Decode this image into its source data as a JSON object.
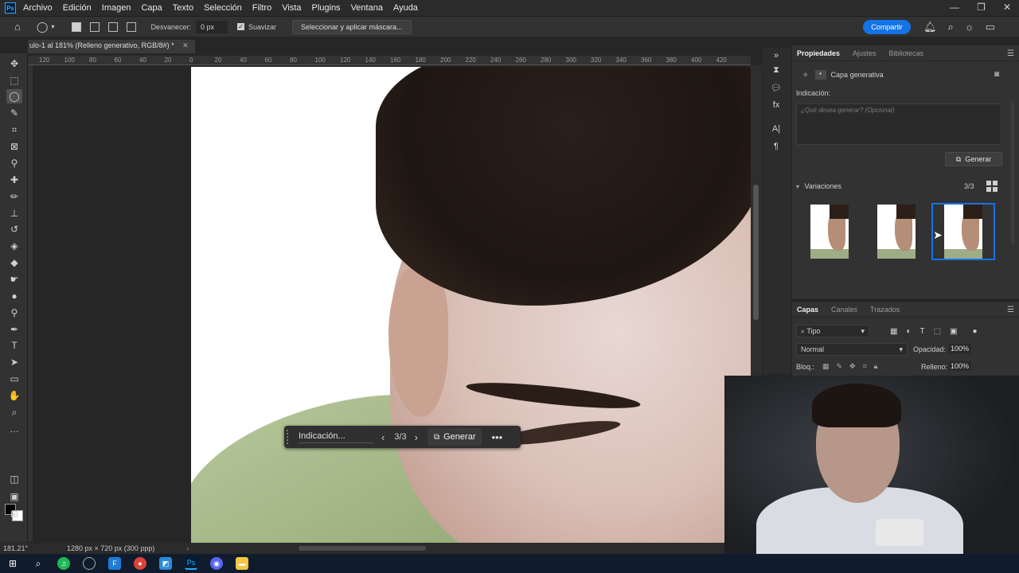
{
  "menu": {
    "items": [
      "Archivo",
      "Edición",
      "Imagen",
      "Capa",
      "Texto",
      "Selección",
      "Filtro",
      "Vista",
      "Plugins",
      "Ventana",
      "Ayuda"
    ]
  },
  "options": {
    "feather_label": "Desvanecer:",
    "feather_value": "0 px",
    "smooth_label": "Suavizar",
    "mask_button": "Seleccionar y aplicar máscara...",
    "share_button": "Compartir"
  },
  "document": {
    "tab_title": "ulo-1 al 181% (Relleno generativo, RGB/8#) *",
    "ruler_labels": [
      "120",
      "100",
      "80",
      "60",
      "40",
      "20",
      "0",
      "20",
      "40",
      "60",
      "80",
      "100",
      "120",
      "140",
      "160",
      "180",
      "200",
      "220",
      "240",
      "260",
      "280",
      "300",
      "320",
      "340",
      "360",
      "380",
      "400",
      "420"
    ]
  },
  "context_bar": {
    "prompt": "Indicación...",
    "count": "3/3",
    "generate": "Generar"
  },
  "status": {
    "zoom": "181.21°",
    "doc_info": "1280 px × 720 px (300 ppp)"
  },
  "properties": {
    "tabs": [
      "Propiedades",
      "Ajustes",
      "Bibliotecas"
    ],
    "layer_type": "Capa generativa",
    "prompt_label": "Indicación:",
    "prompt_placeholder": "¿Qué desea generar? (Opcional)",
    "generate_button": "Generar",
    "variations_label": "Variaciones",
    "variations_count": "3/3"
  },
  "layers": {
    "tabs": [
      "Capas",
      "Canales",
      "Trazados"
    ],
    "filter": "Tipo",
    "blend_mode": "Normal",
    "opacity_label": "Opacidad:",
    "opacity_value": "100%",
    "lock_label": "Bloq.:",
    "fill_label": "Relleno:",
    "fill_value": "100%"
  },
  "colors": {
    "accent": "#1473e6",
    "ps_blue": "#31a8ff"
  }
}
